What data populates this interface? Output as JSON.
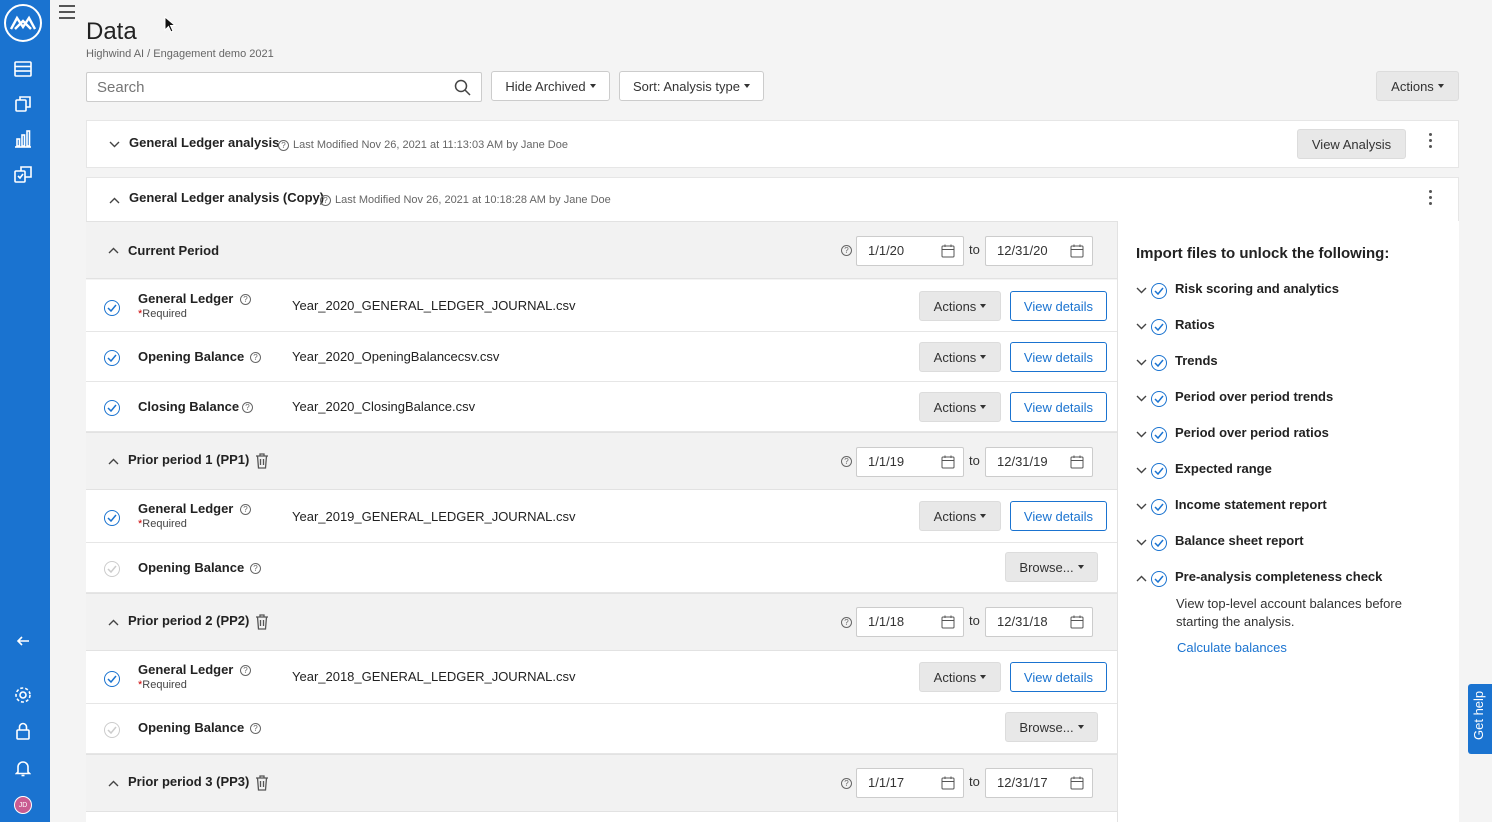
{
  "page": {
    "title": "Data",
    "breadcrumb": "Highwind AI / Engagement demo 2021"
  },
  "toolbar": {
    "search_placeholder": "Search",
    "hide_archived": "Hide Archived",
    "sort": "Sort: Analysis type",
    "actions": "Actions"
  },
  "analyses": [
    {
      "name": "General Ledger analysis",
      "meta": "Last Modified Nov 26, 2021 at 11:13:03 AM by Jane Doe",
      "view_label": "View Analysis"
    },
    {
      "name": "General Ledger analysis (Copy)",
      "meta": "Last Modified Nov 26, 2021 at 10:18:28 AM by Jane Doe"
    }
  ],
  "periods": [
    {
      "name": "Current Period",
      "from": "1/1/20",
      "to": "12/31/20",
      "rows": [
        {
          "label": "General Ledger",
          "required": "Required",
          "file": "Year_2020_GENERAL_LEDGER_JOURNAL.csv"
        },
        {
          "label": "Opening Balance",
          "file": "Year_2020_OpeningBalancecsv.csv"
        },
        {
          "label": "Closing Balance",
          "file": "Year_2020_ClosingBalance.csv"
        }
      ]
    },
    {
      "name": "Prior period 1 (PP1)",
      "from": "1/1/19",
      "to": "12/31/19",
      "rows": [
        {
          "label": "General Ledger",
          "required": "Required",
          "file": "Year_2019_GENERAL_LEDGER_JOURNAL.csv"
        },
        {
          "label": "Opening Balance",
          "file": ""
        }
      ]
    },
    {
      "name": "Prior period 2 (PP2)",
      "from": "1/1/18",
      "to": "12/31/18",
      "rows": [
        {
          "label": "General Ledger",
          "required": "Required",
          "file": "Year_2018_GENERAL_LEDGER_JOURNAL.csv"
        },
        {
          "label": "Opening Balance",
          "file": ""
        }
      ]
    },
    {
      "name": "Prior period 3 (PP3)",
      "from": "1/1/17",
      "to": "12/31/17",
      "rows": []
    }
  ],
  "labels": {
    "to": "to",
    "actions": "Actions",
    "view_details": "View details",
    "browse": "Browse..."
  },
  "side_panel": {
    "heading": "Import files to unlock the following:",
    "features": [
      "Risk scoring and analytics",
      "Ratios",
      "Trends",
      "Period over period trends",
      "Period over period ratios",
      "Expected range",
      "Income statement report",
      "Balance sheet report",
      "Pre-analysis completeness check"
    ],
    "expanded_desc": "View top-level account balances before starting the analysis.",
    "calc_link": "Calculate balances"
  },
  "help_tab": "Get help",
  "avatar_initials": "JD",
  "colors": {
    "primary": "#1a73d0",
    "required": "#cc0000"
  }
}
